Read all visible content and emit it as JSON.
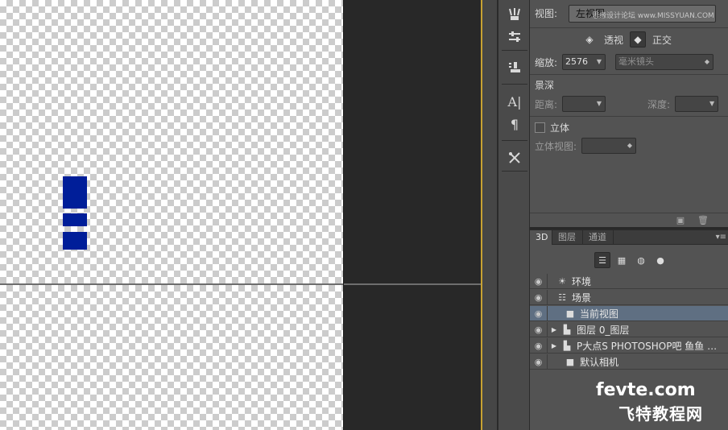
{
  "properties": {
    "view_label": "视图:",
    "view_value": "左视图",
    "perspective_label": "透视",
    "orthographic_label": "正交",
    "zoom_label": "缩放:",
    "zoom_value": "2576",
    "lens_value": "毫米镜头",
    "dof_heading": "景深",
    "distance_label": "距离:",
    "depth_label": "深度:",
    "stereo_label": "立体",
    "stereo_view_label": "立体视图:",
    "site_watermark": "思缘设计论坛 www.MISSYUAN.COM"
  },
  "layers_panel": {
    "tabs": [
      "3D",
      "图层",
      "通道"
    ],
    "active_tab": "3D",
    "items": [
      {
        "name": "环境",
        "icon": "environment-icon"
      },
      {
        "name": "场景",
        "icon": "scene-icon"
      },
      {
        "name": "当前视图",
        "icon": "camera-icon",
        "selected": true
      },
      {
        "name": "图层 0_图层",
        "icon": "folder-icon",
        "expandable": true
      },
      {
        "name": "P大点S PHOTOSHOP吧 鱼鱼 an...",
        "icon": "folder-icon",
        "expandable": true
      },
      {
        "name": "默认相机",
        "icon": "camera-icon"
      }
    ]
  },
  "watermark": {
    "top": "fevte.com",
    "bottom": "飞特教程网"
  },
  "colors": {
    "blue_blocks": "#001e99",
    "selected_row": "#5f6f82",
    "panel_bg": "#535353"
  }
}
